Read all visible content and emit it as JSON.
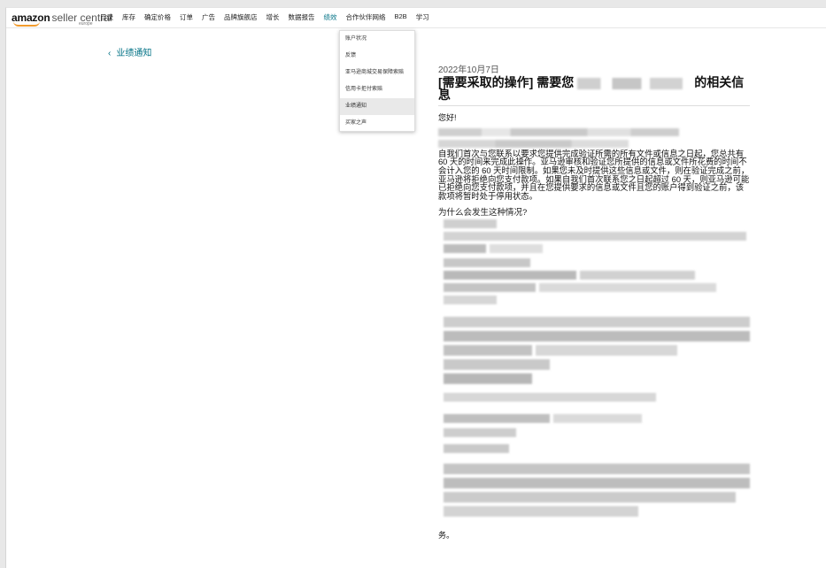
{
  "header": {
    "brand": "amazon",
    "product": "seller central",
    "region": "europe"
  },
  "nav": {
    "items": [
      "目录",
      "库存",
      "确定价格",
      "订单",
      "广告",
      "品牌旗舰店",
      "增长",
      "数据报告",
      "绩效",
      "合作伙伴网络",
      "B2B",
      "学习"
    ],
    "active_index": 8
  },
  "performance_menu": {
    "items": [
      "账户状况",
      "反馈",
      "亚马逊商城交易保障索赔",
      "信用卡拒付索赔",
      "业绩通知",
      "买家之声"
    ],
    "selected_index": 4
  },
  "back_link": {
    "label": "业绩通知"
  },
  "notice": {
    "date": "2022年10月7日",
    "title_prefix": "[需要采取的操作] 需要您",
    "title_suffix": "的相关信息",
    "greeting": "您好!",
    "para": "自我们首次与您联系以要求您提供完成验证所需的所有文件或信息之日起，您总共有 60 天的时间来完成此操作。亚马逊审核和验证您所提供的信息或文件所花费的时间不会计入您的 60 天时间限制。如果您未及时提供这些信息或文件，则在验证完成之前，亚马逊将拒绝向您支付款项。如果自我们首次联系您之日起超过 60 天，则亚马逊可能已拒绝向您支付款项，并且在您提供要求的信息或文件且您的账户得到验证之前，该款项将暂时处于停用状态。",
    "why_heading": "为什么会发生这种情况?",
    "tail": "务。"
  }
}
